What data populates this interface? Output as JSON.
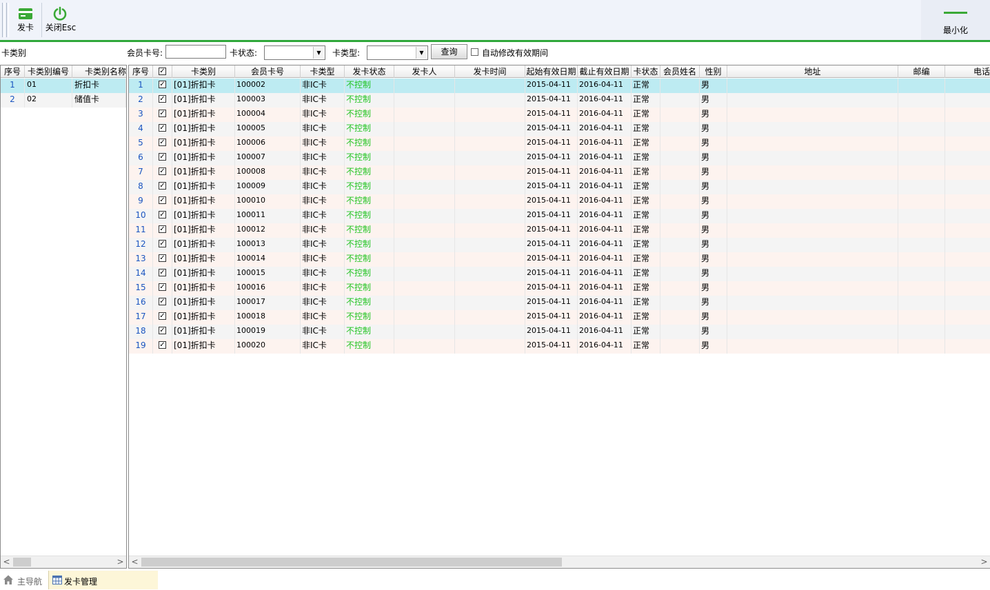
{
  "toolbar": {
    "issue_card_label": "发卡",
    "close_label": "关闭Esc",
    "minimize_label": "最小化"
  },
  "filter": {
    "card_category_label": "卡类别",
    "member_card_no_label": "会员卡号:",
    "member_card_no_value": "",
    "card_status_label": "卡状态:",
    "card_status_value": "",
    "card_type_label": "卡类型:",
    "card_type_value": "",
    "query_button": "查询",
    "auto_modify_label": "自动修改有效期间",
    "auto_modify_checked": false
  },
  "category_table": {
    "columns": [
      "序号",
      "卡类别编号",
      "卡类别名称"
    ],
    "rows": [
      {
        "idx": "1",
        "code": "01",
        "name": "折扣卡"
      },
      {
        "idx": "2",
        "code": "02",
        "name": "储值卡"
      }
    ]
  },
  "card_table": {
    "columns": [
      "序号",
      "",
      "卡类别",
      "会员卡号",
      "卡类型",
      "发卡状态",
      "发卡人",
      "发卡时间",
      "起始有效日期",
      "截止有效日期",
      "卡状态",
      "会员姓名",
      "性别",
      "地址",
      "邮编",
      "电话"
    ],
    "rows": [
      {
        "idx": "1",
        "checked": true,
        "category": "[01]折扣卡",
        "card_no": "100002",
        "card_type": "非IC卡",
        "issue_status": "不控制",
        "issuer": "",
        "issue_time": "",
        "start": "2015-04-11",
        "end": "2016-04-11",
        "status": "正常",
        "name": "",
        "gender": "男"
      },
      {
        "idx": "2",
        "checked": true,
        "category": "[01]折扣卡",
        "card_no": "100003",
        "card_type": "非IC卡",
        "issue_status": "不控制",
        "issuer": "",
        "issue_time": "",
        "start": "2015-04-11",
        "end": "2016-04-11",
        "status": "正常",
        "name": "",
        "gender": "男"
      },
      {
        "idx": "3",
        "checked": true,
        "category": "[01]折扣卡",
        "card_no": "100004",
        "card_type": "非IC卡",
        "issue_status": "不控制",
        "issuer": "",
        "issue_time": "",
        "start": "2015-04-11",
        "end": "2016-04-11",
        "status": "正常",
        "name": "",
        "gender": "男"
      },
      {
        "idx": "4",
        "checked": true,
        "category": "[01]折扣卡",
        "card_no": "100005",
        "card_type": "非IC卡",
        "issue_status": "不控制",
        "issuer": "",
        "issue_time": "",
        "start": "2015-04-11",
        "end": "2016-04-11",
        "status": "正常",
        "name": "",
        "gender": "男"
      },
      {
        "idx": "5",
        "checked": true,
        "category": "[01]折扣卡",
        "card_no": "100006",
        "card_type": "非IC卡",
        "issue_status": "不控制",
        "issuer": "",
        "issue_time": "",
        "start": "2015-04-11",
        "end": "2016-04-11",
        "status": "正常",
        "name": "",
        "gender": "男"
      },
      {
        "idx": "6",
        "checked": true,
        "category": "[01]折扣卡",
        "card_no": "100007",
        "card_type": "非IC卡",
        "issue_status": "不控制",
        "issuer": "",
        "issue_time": "",
        "start": "2015-04-11",
        "end": "2016-04-11",
        "status": "正常",
        "name": "",
        "gender": "男"
      },
      {
        "idx": "7",
        "checked": true,
        "category": "[01]折扣卡",
        "card_no": "100008",
        "card_type": "非IC卡",
        "issue_status": "不控制",
        "issuer": "",
        "issue_time": "",
        "start": "2015-04-11",
        "end": "2016-04-11",
        "status": "正常",
        "name": "",
        "gender": "男"
      },
      {
        "idx": "8",
        "checked": true,
        "category": "[01]折扣卡",
        "card_no": "100009",
        "card_type": "非IC卡",
        "issue_status": "不控制",
        "issuer": "",
        "issue_time": "",
        "start": "2015-04-11",
        "end": "2016-04-11",
        "status": "正常",
        "name": "",
        "gender": "男"
      },
      {
        "idx": "9",
        "checked": true,
        "category": "[01]折扣卡",
        "card_no": "100010",
        "card_type": "非IC卡",
        "issue_status": "不控制",
        "issuer": "",
        "issue_time": "",
        "start": "2015-04-11",
        "end": "2016-04-11",
        "status": "正常",
        "name": "",
        "gender": "男"
      },
      {
        "idx": "10",
        "checked": true,
        "category": "[01]折扣卡",
        "card_no": "100011",
        "card_type": "非IC卡",
        "issue_status": "不控制",
        "issuer": "",
        "issue_time": "",
        "start": "2015-04-11",
        "end": "2016-04-11",
        "status": "正常",
        "name": "",
        "gender": "男"
      },
      {
        "idx": "11",
        "checked": true,
        "category": "[01]折扣卡",
        "card_no": "100012",
        "card_type": "非IC卡",
        "issue_status": "不控制",
        "issuer": "",
        "issue_time": "",
        "start": "2015-04-11",
        "end": "2016-04-11",
        "status": "正常",
        "name": "",
        "gender": "男"
      },
      {
        "idx": "12",
        "checked": true,
        "category": "[01]折扣卡",
        "card_no": "100013",
        "card_type": "非IC卡",
        "issue_status": "不控制",
        "issuer": "",
        "issue_time": "",
        "start": "2015-04-11",
        "end": "2016-04-11",
        "status": "正常",
        "name": "",
        "gender": "男"
      },
      {
        "idx": "13",
        "checked": true,
        "category": "[01]折扣卡",
        "card_no": "100014",
        "card_type": "非IC卡",
        "issue_status": "不控制",
        "issuer": "",
        "issue_time": "",
        "start": "2015-04-11",
        "end": "2016-04-11",
        "status": "正常",
        "name": "",
        "gender": "男"
      },
      {
        "idx": "14",
        "checked": true,
        "category": "[01]折扣卡",
        "card_no": "100015",
        "card_type": "非IC卡",
        "issue_status": "不控制",
        "issuer": "",
        "issue_time": "",
        "start": "2015-04-11",
        "end": "2016-04-11",
        "status": "正常",
        "name": "",
        "gender": "男"
      },
      {
        "idx": "15",
        "checked": true,
        "category": "[01]折扣卡",
        "card_no": "100016",
        "card_type": "非IC卡",
        "issue_status": "不控制",
        "issuer": "",
        "issue_time": "",
        "start": "2015-04-11",
        "end": "2016-04-11",
        "status": "正常",
        "name": "",
        "gender": "男"
      },
      {
        "idx": "16",
        "checked": true,
        "category": "[01]折扣卡",
        "card_no": "100017",
        "card_type": "非IC卡",
        "issue_status": "不控制",
        "issuer": "",
        "issue_time": "",
        "start": "2015-04-11",
        "end": "2016-04-11",
        "status": "正常",
        "name": "",
        "gender": "男"
      },
      {
        "idx": "17",
        "checked": true,
        "category": "[01]折扣卡",
        "card_no": "100018",
        "card_type": "非IC卡",
        "issue_status": "不控制",
        "issuer": "",
        "issue_time": "",
        "start": "2015-04-11",
        "end": "2016-04-11",
        "status": "正常",
        "name": "",
        "gender": "男"
      },
      {
        "idx": "18",
        "checked": true,
        "category": "[01]折扣卡",
        "card_no": "100019",
        "card_type": "非IC卡",
        "issue_status": "不控制",
        "issuer": "",
        "issue_time": "",
        "start": "2015-04-11",
        "end": "2016-04-11",
        "status": "正常",
        "name": "",
        "gender": "男"
      },
      {
        "idx": "19",
        "checked": true,
        "category": "[01]折扣卡",
        "card_no": "100020",
        "card_type": "非IC卡",
        "issue_status": "不控制",
        "issuer": "",
        "issue_time": "",
        "start": "2015-04-11",
        "end": "2016-04-11",
        "status": "正常",
        "name": "",
        "gender": "男"
      }
    ]
  },
  "tabs": [
    {
      "label": "主导航",
      "icon": "home-icon"
    },
    {
      "label": "发卡管理",
      "icon": "table-icon"
    }
  ],
  "colors": {
    "accent_green": "#2fa83a",
    "issue_status_green": "#22c422",
    "index_blue": "#1a55c0",
    "selected_row": "#bdebf2",
    "row_even": "#f4f4f4",
    "row_odd": "#fdf3ef"
  }
}
